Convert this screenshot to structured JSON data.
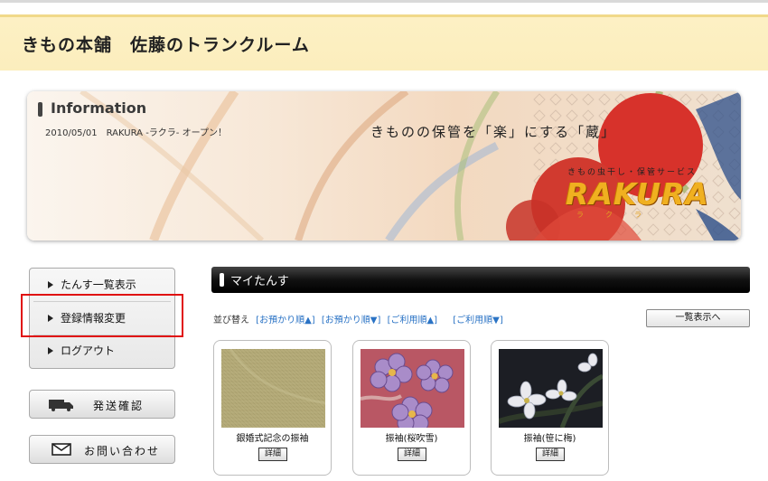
{
  "header": {
    "title": "きもの本舗　佐藤のトランクルーム"
  },
  "banner": {
    "info_title": "Information",
    "news": "2010/05/01　RAKURA -ラクラ- オープン！",
    "catchcopy": "きものの保管を「楽」にする「蔵」",
    "service_subtitle": "きもの虫干し・保管サービス",
    "logo": "RAKURA",
    "logo_ruby": "ラクラ"
  },
  "sidebar": {
    "menu": [
      {
        "label": "たんす一覧表示"
      },
      {
        "label": "登録情報変更"
      },
      {
        "label": "ログアウト"
      }
    ],
    "shipping_label": "発送確認",
    "contact_label": "お問い合わせ"
  },
  "main": {
    "section_title": "マイたんす",
    "sort_label": "並び替え",
    "sort_options": [
      "[お預かり順▲]",
      "[お預かり順▼]",
      "[ご利用順▲]",
      "[ご利用順▼]"
    ],
    "list_button": "一覧表示へ",
    "detail_label": "詳細",
    "items": [
      {
        "name": "銀婚式記念の振袖"
      },
      {
        "name": "振袖(桜吹雪)"
      },
      {
        "name": "振袖(笹に梅)"
      }
    ]
  },
  "colors": {
    "header_bg": "#fbeebd",
    "highlight": "#e01010",
    "link": "#2a73c5",
    "logo": "#f0b020"
  }
}
